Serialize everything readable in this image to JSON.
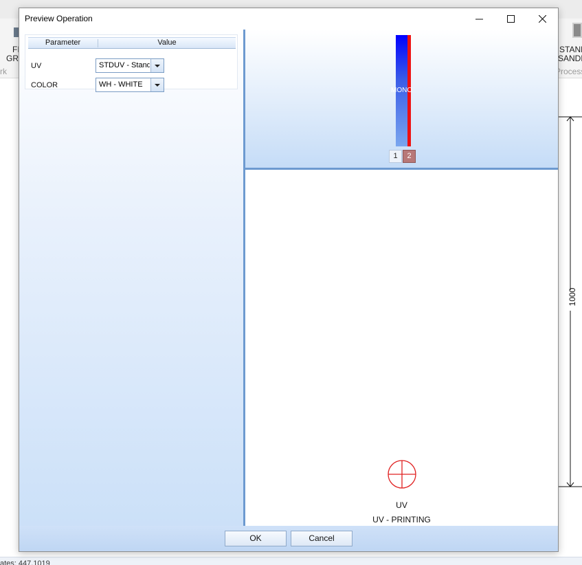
{
  "background_app": {
    "ribbon": {
      "left_button_lines": [
        "FI",
        "GRO"
      ],
      "left_group_label": "rk",
      "right_button_lines": [
        "STAND",
        "SANDE"
      ],
      "right_group_label": "Process"
    },
    "dimension_value": "1000",
    "status_text": "ates:  447,1019"
  },
  "dialog": {
    "title": "Preview Operation",
    "parameters": {
      "headers": {
        "parameter": "Parameter",
        "value": "Value"
      },
      "rows": [
        {
          "label": "UV",
          "value": "STDUV - Standard UV"
        },
        {
          "label": "COLOR",
          "value": "WH - WHITE"
        }
      ]
    },
    "preview": {
      "layer_label": "MONO",
      "layer_colors": {
        "bar_top": "#0000ff",
        "bar_bottom": "#7aa6ee",
        "edge": "#ee1010"
      },
      "pages": [
        "1",
        "2"
      ],
      "selected_page": "2",
      "operation_name": "UV",
      "operation_description": "UV - PRINTING",
      "marker_color": "#e02020"
    },
    "buttons": {
      "ok": "OK",
      "cancel": "Cancel"
    }
  }
}
